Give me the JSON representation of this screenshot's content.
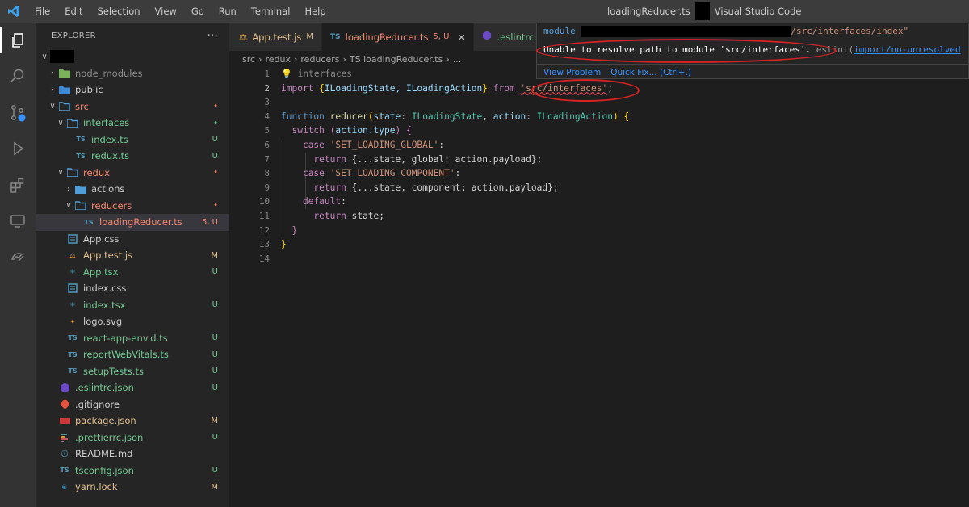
{
  "titlebar": {
    "menu": [
      "File",
      "Edit",
      "Selection",
      "View",
      "Go",
      "Run",
      "Terminal",
      "Help"
    ],
    "file_name": "loadingReducer.ts",
    "app_name": "Visual Studio Code"
  },
  "sidebar": {
    "header": "EXPLORER",
    "more": "···",
    "items": [
      {
        "name": "",
        "status": ""
      },
      {
        "name": "node_modules",
        "status": ""
      },
      {
        "name": "public",
        "status": ""
      },
      {
        "name": "src",
        "status": "•"
      },
      {
        "name": "interfaces",
        "status": "•"
      },
      {
        "name": "index.ts",
        "status": "U"
      },
      {
        "name": "redux.ts",
        "status": "U"
      },
      {
        "name": "redux",
        "status": "•"
      },
      {
        "name": "actions",
        "status": ""
      },
      {
        "name": "reducers",
        "status": "•"
      },
      {
        "name": "loadingReducer.ts",
        "status": "5, U"
      },
      {
        "name": "App.css",
        "status": ""
      },
      {
        "name": "App.test.js",
        "status": "M"
      },
      {
        "name": "App.tsx",
        "status": "U"
      },
      {
        "name": "index.css",
        "status": ""
      },
      {
        "name": "index.tsx",
        "status": "U"
      },
      {
        "name": "logo.svg",
        "status": ""
      },
      {
        "name": "react-app-env.d.ts",
        "status": "U"
      },
      {
        "name": "reportWebVitals.ts",
        "status": "U"
      },
      {
        "name": "setupTests.ts",
        "status": "U"
      },
      {
        "name": ".eslintrc.json",
        "status": "U"
      },
      {
        "name": ".gitignore",
        "status": ""
      },
      {
        "name": "package.json",
        "status": "M"
      },
      {
        "name": ".prettierrc.json",
        "status": "U"
      },
      {
        "name": "README.md",
        "status": ""
      },
      {
        "name": "tsconfig.json",
        "status": "U"
      },
      {
        "name": "yarn.lock",
        "status": "M"
      }
    ]
  },
  "tabs": [
    {
      "label": "App.test.js",
      "badge": "M"
    },
    {
      "label": "loadingReducer.ts",
      "badge": "5, U",
      "close": "×"
    },
    {
      "label": ".eslintrc.j",
      "badge": ""
    }
  ],
  "breadcrumb": [
    "src",
    "redux",
    "reducers",
    "TS loadingReducer.ts",
    "..."
  ],
  "editor": {
    "line_numbers": [
      "1",
      "2",
      "3",
      "4",
      "5",
      "6",
      "7",
      "8",
      "9",
      "10",
      "11",
      "12",
      "13",
      "14"
    ],
    "line1_hint": "interfaces",
    "line2": {
      "import": "import",
      "open": " {",
      "names": "ILoadingState, ILoadingAction",
      "close": "} ",
      "from": "from",
      "path": "'src/interfaces'",
      "semi": ";"
    },
    "line4": {
      "kw": "function",
      "name": "reducer",
      "p1": "state",
      "t1": "ILoadingState",
      "p2": "action",
      "t2": "ILoadingAction"
    },
    "line5": {
      "kw": "switch",
      "expr": "action.type"
    },
    "line6": {
      "kw": "case",
      "val": "'SET_LOADING_GLOBAL'"
    },
    "line7": {
      "kw": "return",
      "body": "{...state, global: action.payload};"
    },
    "line8": {
      "kw": "case",
      "val": "'SET_LOADING_COMPONENT'"
    },
    "line9": {
      "kw": "return",
      "body": "{...state, component: action.payload};"
    },
    "line10": {
      "kw": "default"
    },
    "line11": {
      "kw": "return",
      "body": "state;"
    }
  },
  "hover": {
    "module_prefix": "module",
    "module_path_suffix": "/src/interfaces/index\"",
    "error": "Unable to resolve path to module 'src/interfaces'.",
    "source": "eslint(",
    "rule": "import/no-unresolved",
    "action_view": "View Problem",
    "action_fix": "Quick Fix... (Ctrl+.)"
  },
  "colors": {
    "error_annotation": "#d62222",
    "link": "#3794ff"
  }
}
